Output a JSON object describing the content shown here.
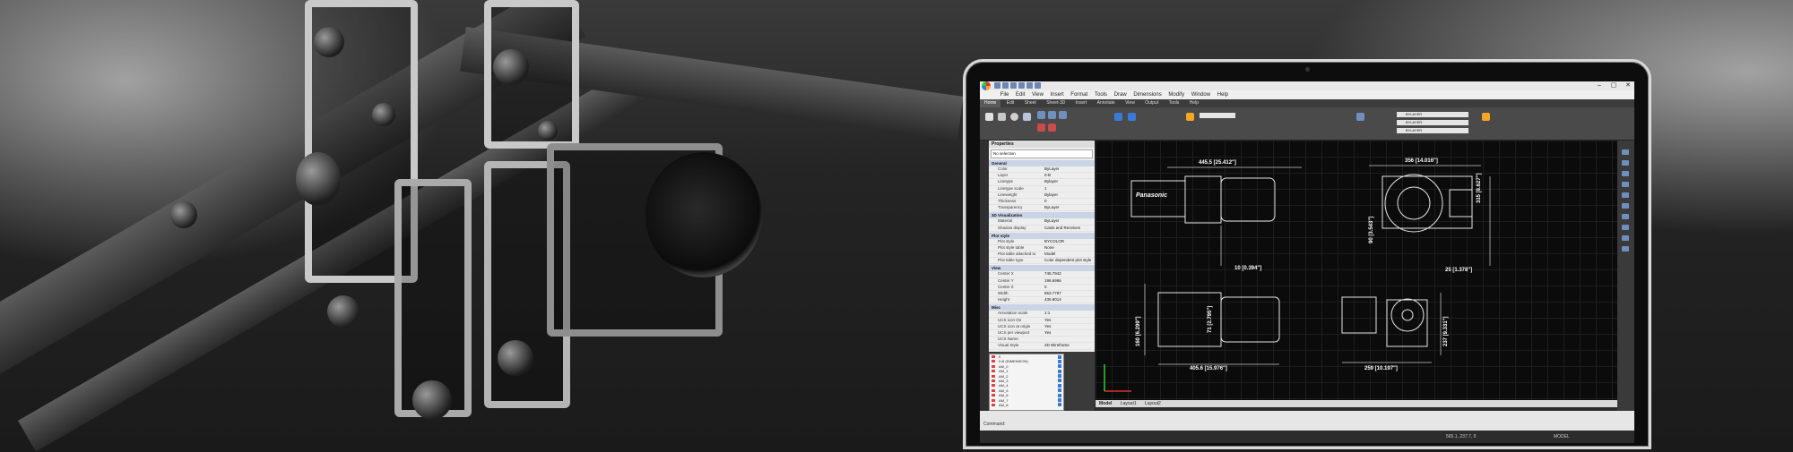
{
  "window": {
    "title_controls": [
      "–",
      "▢",
      "✕"
    ]
  },
  "menu": [
    "File",
    "Edit",
    "View",
    "Insert",
    "Format",
    "Tools",
    "Draw",
    "Dimensions",
    "Modify",
    "Window",
    "Help"
  ],
  "ribbon_tabs": [
    "Home",
    "Edit",
    "Sheet",
    "Sheet-3D",
    "Insert",
    "Annotate",
    "View",
    "Output",
    "Tools",
    "Help"
  ],
  "ribbon_active_tab": "Home",
  "ribbon_layer_values": [
    "BYLAYER",
    "BYLAYER",
    "BYLAYER"
  ],
  "properties": {
    "header": "Properties",
    "selection": "No selection",
    "categories": [
      {
        "name": "General",
        "rows": [
          {
            "k": "Color",
            "v": "ByLayer"
          },
          {
            "k": "Layer",
            "v": "0-B"
          },
          {
            "k": "Linetype",
            "v": "Bylayer"
          },
          {
            "k": "Linetype scale",
            "v": "1"
          },
          {
            "k": "Lineweight",
            "v": "Bylayer"
          },
          {
            "k": "Thickness",
            "v": "0"
          },
          {
            "k": "Transparency",
            "v": "ByLayer"
          }
        ]
      },
      {
        "name": "3D Visualization",
        "rows": [
          {
            "k": "Material",
            "v": "ByLayer"
          },
          {
            "k": "Shadow display",
            "v": "Casts and Receives"
          }
        ]
      },
      {
        "name": "Plot style",
        "rows": [
          {
            "k": "Plot style",
            "v": "BYCOLOR"
          },
          {
            "k": "Plot style table",
            "v": "None"
          },
          {
            "k": "Plot table attached to",
            "v": "Model"
          },
          {
            "k": "Plot table type",
            "v": "Color dependent plot style"
          }
        ]
      },
      {
        "name": "View",
        "rows": [
          {
            "k": "Center X",
            "v": "745.7942"
          },
          {
            "k": "Center Y",
            "v": "196.6966"
          },
          {
            "k": "Center Z",
            "v": "0"
          },
          {
            "k": "Width",
            "v": "853.7787"
          },
          {
            "k": "Height",
            "v": "436.8014"
          }
        ]
      },
      {
        "name": "Misc",
        "rows": [
          {
            "k": "Annotation scale",
            "v": "1:1"
          },
          {
            "k": "UCS icon On",
            "v": "Yes"
          },
          {
            "k": "UCS icon at origin",
            "v": "Yes"
          },
          {
            "k": "UCS per viewport",
            "v": "Yes"
          },
          {
            "k": "UCS Name",
            "v": ""
          },
          {
            "k": "Visual Style",
            "v": "2D Wireframe"
          }
        ]
      }
    ]
  },
  "layers": [
    "0",
    "0-B (DIMENSION)",
    "AM_0",
    "AM_1",
    "AM_2",
    "AM_3",
    "AM_4",
    "AM_5",
    "AM_6",
    "AM_7",
    "AM_8"
  ],
  "drawing": {
    "dimensions": [
      "445.5 [25.412\"]",
      "356 [14.016\"]",
      "10 [0.394\"]",
      "25 [1.378\"]",
      "315 [8.627\"]",
      "90 [3.543\"]",
      "71 [2.795\"]",
      "160 [6.299\"]",
      "405.6 [15.976\"]",
      "259 [10.197\"]",
      "237 [9.331\"]"
    ],
    "brand_label": "Panasonic"
  },
  "layout_tabs": [
    "Model",
    "Layout1",
    "Layout2"
  ],
  "command": {
    "prompt": "Command:"
  },
  "status": {
    "coords": "565.1, 237.7, 0",
    "mode": "MODEL"
  }
}
